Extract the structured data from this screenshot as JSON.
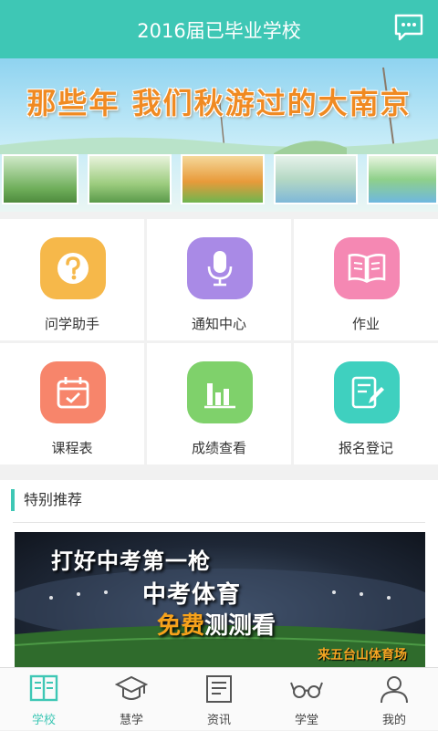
{
  "header": {
    "title": "2016届已毕业学校"
  },
  "banner": {
    "text": "那些年 我们秋游过的大南京"
  },
  "grid": [
    {
      "label": "问学助手",
      "color": "#f6b84a",
      "icon": "question-icon"
    },
    {
      "label": "通知中心",
      "color": "#a98ae6",
      "icon": "microphone-icon"
    },
    {
      "label": "作业",
      "color": "#f588b3",
      "icon": "book-icon"
    },
    {
      "label": "课程表",
      "color": "#f7856b",
      "icon": "calendar-icon"
    },
    {
      "label": "成绩查看",
      "color": "#7fd16b",
      "icon": "bar-chart-icon"
    },
    {
      "label": "报名登记",
      "color": "#3fd0bf",
      "icon": "form-edit-icon"
    }
  ],
  "section": {
    "title": "特别推荐"
  },
  "promo": {
    "line1": "打好中考第一枪",
    "line2": "中考体育",
    "line3_highlight": "免费",
    "line3_rest": "测测看",
    "venue": "来五台山体育场"
  },
  "tabs": [
    {
      "label": "学校",
      "icon": "school-book-icon",
      "active": true
    },
    {
      "label": "慧学",
      "icon": "graduation-cap-icon"
    },
    {
      "label": "资讯",
      "icon": "news-icon"
    },
    {
      "label": "学堂",
      "icon": "glasses-icon"
    },
    {
      "label": "我的",
      "icon": "user-icon"
    }
  ],
  "colors": {
    "accent": "#3ec7b5",
    "banner_text": "#f08a22",
    "promo_highlight": "#f7a21b"
  }
}
